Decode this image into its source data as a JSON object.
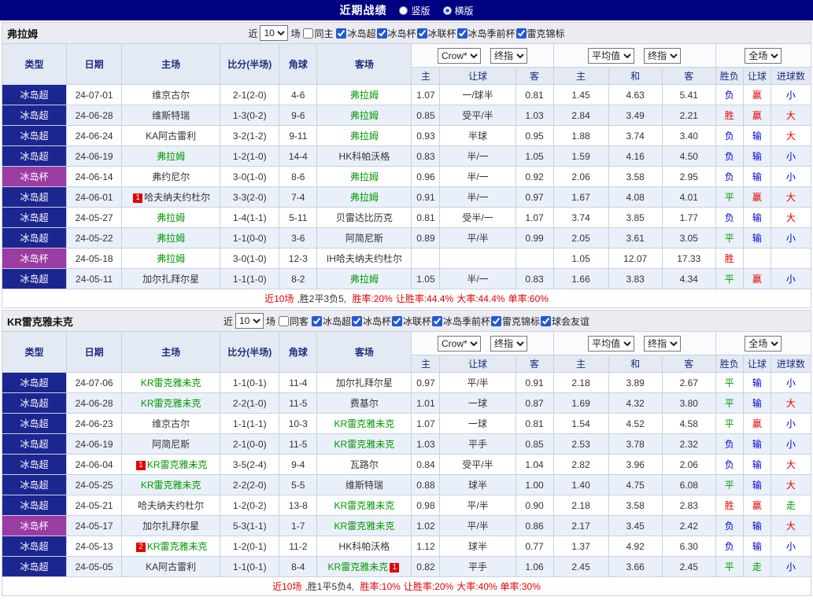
{
  "title_bar": {
    "title": "近期战绩",
    "vertical_label": "竖版",
    "horizontal_label": "横版"
  },
  "table_header": {
    "near_label": "近",
    "count_value": "10",
    "unit_label": "场",
    "cols": [
      "类型",
      "日期",
      "主场",
      "比分(半场)",
      "角球",
      "客场"
    ],
    "sub_cols": [
      "主",
      "让球",
      "客",
      "主",
      "和",
      "客",
      "胜负",
      "让球",
      "进球数"
    ],
    "dropdown_company": "Crow*",
    "dropdown_final1": "终指",
    "dropdown_avg": "平均值",
    "dropdown_final2": "终指",
    "dropdown_scope": "全场"
  },
  "colors": {
    "navy": "#1c2690",
    "purple": "#9c3ba2",
    "focal_team_green": "#009900",
    "win_red": "#e60000",
    "lose_blue": "#0000d5",
    "draw_green": "#00a000"
  },
  "sections": [
    {
      "team": "弗拉姆",
      "same_label": "同主",
      "leagues": [
        "冰岛超",
        "冰岛杯",
        "冰联杯",
        "冰岛季前杯",
        "雷克锦标"
      ],
      "rows": [
        {
          "type": "冰岛超",
          "cup": false,
          "date": "24-07-01",
          "home": {
            "name": "维京古尔"
          },
          "score": "2-1(2-0)",
          "corner": "4-6",
          "away": {
            "name": "弗拉姆",
            "green": true
          },
          "odds": [
            "1.07",
            "一/球半",
            "0.81",
            "1.45",
            "4.63",
            "5.41"
          ],
          "results": [
            {
              "t": "负",
              "c": "blue"
            },
            {
              "t": "赢",
              "c": "red"
            },
            {
              "t": "小",
              "c": "blue"
            }
          ]
        },
        {
          "type": "冰岛超",
          "cup": false,
          "date": "24-06-28",
          "home": {
            "name": "维斯特瑞"
          },
          "score": "1-3(0-2)",
          "corner": "9-6",
          "away": {
            "name": "弗拉姆",
            "green": true
          },
          "odds": [
            "0.85",
            "受平/半",
            "1.03",
            "2.84",
            "3.49",
            "2.21"
          ],
          "results": [
            {
              "t": "胜",
              "c": "red"
            },
            {
              "t": "赢",
              "c": "red"
            },
            {
              "t": "大",
              "c": "red"
            }
          ]
        },
        {
          "type": "冰岛超",
          "cup": false,
          "date": "24-06-24",
          "home": {
            "name": "KA阿古雷利"
          },
          "score": "3-2(1-2)",
          "corner": "9-11",
          "away": {
            "name": "弗拉姆",
            "green": true
          },
          "odds": [
            "0.93",
            "半球",
            "0.95",
            "1.88",
            "3.74",
            "3.40"
          ],
          "results": [
            {
              "t": "负",
              "c": "blue"
            },
            {
              "t": "输",
              "c": "blue"
            },
            {
              "t": "大",
              "c": "red"
            }
          ]
        },
        {
          "type": "冰岛超",
          "cup": false,
          "date": "24-06-19",
          "home": {
            "name": "弗拉姆",
            "green": true
          },
          "score": "1-2(1-0)",
          "corner": "14-4",
          "away": {
            "name": "HK科帕沃格"
          },
          "odds": [
            "0.83",
            "半/一",
            "1.05",
            "1.59",
            "4.16",
            "4.50"
          ],
          "results": [
            {
              "t": "负",
              "c": "blue"
            },
            {
              "t": "输",
              "c": "blue"
            },
            {
              "t": "小",
              "c": "blue"
            }
          ]
        },
        {
          "type": "冰岛杯",
          "cup": true,
          "date": "24-06-14",
          "home": {
            "name": "弗约尼尔"
          },
          "score": "3-0(1-0)",
          "corner": "8-6",
          "away": {
            "name": "弗拉姆",
            "green": true
          },
          "odds": [
            "0.96",
            "半/一",
            "0.92",
            "2.06",
            "3.58",
            "2.95"
          ],
          "results": [
            {
              "t": "负",
              "c": "blue"
            },
            {
              "t": "输",
              "c": "blue"
            },
            {
              "t": "小",
              "c": "blue"
            }
          ]
        },
        {
          "type": "冰岛超",
          "cup": false,
          "date": "24-06-01",
          "home": {
            "name": "哈夫纳夫约杜尔",
            "badge": "1"
          },
          "score": "3-3(2-0)",
          "corner": "7-4",
          "away": {
            "name": "弗拉姆",
            "green": true
          },
          "odds": [
            "0.91",
            "半/一",
            "0.97",
            "1.67",
            "4.08",
            "4.01"
          ],
          "results": [
            {
              "t": "平",
              "c": "green"
            },
            {
              "t": "赢",
              "c": "red"
            },
            {
              "t": "大",
              "c": "red"
            }
          ]
        },
        {
          "type": "冰岛超",
          "cup": false,
          "date": "24-05-27",
          "home": {
            "name": "弗拉姆",
            "green": true
          },
          "score": "1-4(1-1)",
          "corner": "5-11",
          "away": {
            "name": "贝雷达比历克"
          },
          "odds": [
            "0.81",
            "受半/一",
            "1.07",
            "3.74",
            "3.85",
            "1.77"
          ],
          "results": [
            {
              "t": "负",
              "c": "blue"
            },
            {
              "t": "输",
              "c": "blue"
            },
            {
              "t": "大",
              "c": "red"
            }
          ]
        },
        {
          "type": "冰岛超",
          "cup": false,
          "date": "24-05-22",
          "home": {
            "name": "弗拉姆",
            "green": true
          },
          "score": "1-1(0-0)",
          "corner": "3-6",
          "away": {
            "name": "阿简尼斯"
          },
          "odds": [
            "0.89",
            "平/半",
            "0.99",
            "2.05",
            "3.61",
            "3.05"
          ],
          "results": [
            {
              "t": "平",
              "c": "green"
            },
            {
              "t": "输",
              "c": "blue"
            },
            {
              "t": "小",
              "c": "blue"
            }
          ]
        },
        {
          "type": "冰岛杯",
          "cup": true,
          "date": "24-05-18",
          "home": {
            "name": "弗拉姆",
            "green": true
          },
          "score": "3-0(1-0)",
          "corner": "12-3",
          "away": {
            "name": "IH哈夫纳夫约杜尔"
          },
          "odds": [
            "",
            "",
            "",
            "1.05",
            "12.07",
            "17.33"
          ],
          "results": [
            {
              "t": "胜",
              "c": "red"
            },
            {
              "t": "",
              "c": ""
            },
            {
              "t": "",
              "c": ""
            }
          ]
        },
        {
          "type": "冰岛超",
          "cup": false,
          "date": "24-05-11",
          "home": {
            "name": "加尔扎拜尔星"
          },
          "score": "1-1(1-0)",
          "corner": "8-2",
          "away": {
            "name": "弗拉姆",
            "green": true
          },
          "odds": [
            "1.05",
            "半/一",
            "0.83",
            "1.66",
            "3.83",
            "4.34"
          ],
          "results": [
            {
              "t": "平",
              "c": "green"
            },
            {
              "t": "赢",
              "c": "red"
            },
            {
              "t": "小",
              "c": "blue"
            }
          ]
        }
      ],
      "summary": [
        {
          "text": "近10场",
          "color": "red"
        },
        {
          "text": ",胜2平3负5, ",
          "color": "dark"
        },
        {
          "text": "胜率:20%",
          "color": "red"
        },
        {
          "text": "让胜率:44.4%",
          "color": "red"
        },
        {
          "text": "大率:44.4%",
          "color": "red"
        },
        {
          "text": "单率:60%",
          "color": "red"
        }
      ]
    },
    {
      "team": "KR雷克雅未克",
      "same_label": "同客",
      "leagues": [
        "冰岛超",
        "冰岛杯",
        "冰联杯",
        "冰岛季前杯",
        "雷克锦标",
        "球会友谊"
      ],
      "rows": [
        {
          "type": "冰岛超",
          "cup": false,
          "date": "24-07-06",
          "home": {
            "name": "KR雷克雅未克",
            "green": true
          },
          "score": "1-1(0-1)",
          "corner": "11-4",
          "away": {
            "name": "加尔扎拜尔星"
          },
          "odds": [
            "0.97",
            "平/半",
            "0.91",
            "2.18",
            "3.89",
            "2.67"
          ],
          "results": [
            {
              "t": "平",
              "c": "green"
            },
            {
              "t": "输",
              "c": "blue"
            },
            {
              "t": "小",
              "c": "blue"
            }
          ]
        },
        {
          "type": "冰岛超",
          "cup": false,
          "date": "24-06-28",
          "home": {
            "name": "KR雷克雅未克",
            "green": true
          },
          "score": "2-2(1-0)",
          "corner": "11-5",
          "away": {
            "name": "费基尔"
          },
          "odds": [
            "1.01",
            "一球",
            "0.87",
            "1.69",
            "4.32",
            "3.80"
          ],
          "results": [
            {
              "t": "平",
              "c": "green"
            },
            {
              "t": "输",
              "c": "blue"
            },
            {
              "t": "大",
              "c": "red"
            }
          ]
        },
        {
          "type": "冰岛超",
          "cup": false,
          "date": "24-06-23",
          "home": {
            "name": "维京古尔"
          },
          "score": "1-1(1-1)",
          "corner": "10-3",
          "away": {
            "name": "KR雷克雅未克",
            "green": true
          },
          "odds": [
            "1.07",
            "一球",
            "0.81",
            "1.54",
            "4.52",
            "4.58"
          ],
          "results": [
            {
              "t": "平",
              "c": "green"
            },
            {
              "t": "赢",
              "c": "red"
            },
            {
              "t": "小",
              "c": "blue"
            }
          ]
        },
        {
          "type": "冰岛超",
          "cup": false,
          "date": "24-06-19",
          "home": {
            "name": "阿简尼斯"
          },
          "score": "2-1(0-0)",
          "corner": "11-5",
          "away": {
            "name": "KR雷克雅未克",
            "green": true
          },
          "odds": [
            "1.03",
            "平手",
            "0.85",
            "2.53",
            "3.78",
            "2.32"
          ],
          "results": [
            {
              "t": "负",
              "c": "blue"
            },
            {
              "t": "输",
              "c": "blue"
            },
            {
              "t": "小",
              "c": "blue"
            }
          ]
        },
        {
          "type": "冰岛超",
          "cup": false,
          "date": "24-06-04",
          "home": {
            "name": "KR雷克雅未克",
            "green": true,
            "badge": "1"
          },
          "score": "3-5(2-4)",
          "corner": "9-4",
          "away": {
            "name": "瓦路尔"
          },
          "odds": [
            "0.84",
            "受平/半",
            "1.04",
            "2.82",
            "3.96",
            "2.06"
          ],
          "results": [
            {
              "t": "负",
              "c": "blue"
            },
            {
              "t": "输",
              "c": "blue"
            },
            {
              "t": "大",
              "c": "red"
            }
          ]
        },
        {
          "type": "冰岛超",
          "cup": false,
          "date": "24-05-25",
          "home": {
            "name": "KR雷克雅未克",
            "green": true
          },
          "score": "2-2(2-0)",
          "corner": "5-5",
          "away": {
            "name": "维斯特瑞"
          },
          "odds": [
            "0.88",
            "球半",
            "1.00",
            "1.40",
            "4.75",
            "6.08"
          ],
          "results": [
            {
              "t": "平",
              "c": "green"
            },
            {
              "t": "输",
              "c": "blue"
            },
            {
              "t": "大",
              "c": "red"
            }
          ]
        },
        {
          "type": "冰岛超",
          "cup": false,
          "date": "24-05-21",
          "home": {
            "name": "哈夫纳夫约杜尔"
          },
          "score": "1-2(0-2)",
          "corner": "13-8",
          "away": {
            "name": "KR雷克雅未克",
            "green": true
          },
          "odds": [
            "0.98",
            "平/半",
            "0.90",
            "2.18",
            "3.58",
            "2.83"
          ],
          "results": [
            {
              "t": "胜",
              "c": "red"
            },
            {
              "t": "赢",
              "c": "red"
            },
            {
              "t": "走",
              "c": "green"
            }
          ]
        },
        {
          "type": "冰岛杯",
          "cup": true,
          "date": "24-05-17",
          "home": {
            "name": "加尔扎拜尔星"
          },
          "score": "5-3(1-1)",
          "corner": "1-7",
          "away": {
            "name": "KR雷克雅未克",
            "green": true
          },
          "odds": [
            "1.02",
            "平/半",
            "0.86",
            "2.17",
            "3.45",
            "2.42"
          ],
          "results": [
            {
              "t": "负",
              "c": "blue"
            },
            {
              "t": "输",
              "c": "blue"
            },
            {
              "t": "大",
              "c": "red"
            }
          ]
        },
        {
          "type": "冰岛超",
          "cup": false,
          "date": "24-05-13",
          "home": {
            "name": "KR雷克雅未克",
            "green": true,
            "badge": "2"
          },
          "score": "1-2(0-1)",
          "corner": "11-2",
          "away": {
            "name": "HK科帕沃格"
          },
          "odds": [
            "1.12",
            "球半",
            "0.77",
            "1.37",
            "4.92",
            "6.30"
          ],
          "results": [
            {
              "t": "负",
              "c": "blue"
            },
            {
              "t": "输",
              "c": "blue"
            },
            {
              "t": "小",
              "c": "blue"
            }
          ]
        },
        {
          "type": "冰岛超",
          "cup": false,
          "date": "24-05-05",
          "home": {
            "name": "KA阿古雷利"
          },
          "score": "1-1(0-1)",
          "corner": "8-4",
          "away": {
            "name": "KR雷克雅未克",
            "green": true,
            "badge_after": "1"
          },
          "odds": [
            "0.82",
            "平手",
            "1.06",
            "2.45",
            "3.66",
            "2.45"
          ],
          "results": [
            {
              "t": "平",
              "c": "green"
            },
            {
              "t": "走",
              "c": "green"
            },
            {
              "t": "小",
              "c": "blue"
            }
          ]
        }
      ],
      "summary": [
        {
          "text": "近10场",
          "color": "red"
        },
        {
          "text": ",胜1平5负4, ",
          "color": "dark"
        },
        {
          "text": "胜率:10%",
          "color": "red"
        },
        {
          "text": "让胜率:20%",
          "color": "red"
        },
        {
          "text": "大率:40%",
          "color": "red"
        },
        {
          "text": "单率:30%",
          "color": "red"
        }
      ]
    }
  ]
}
